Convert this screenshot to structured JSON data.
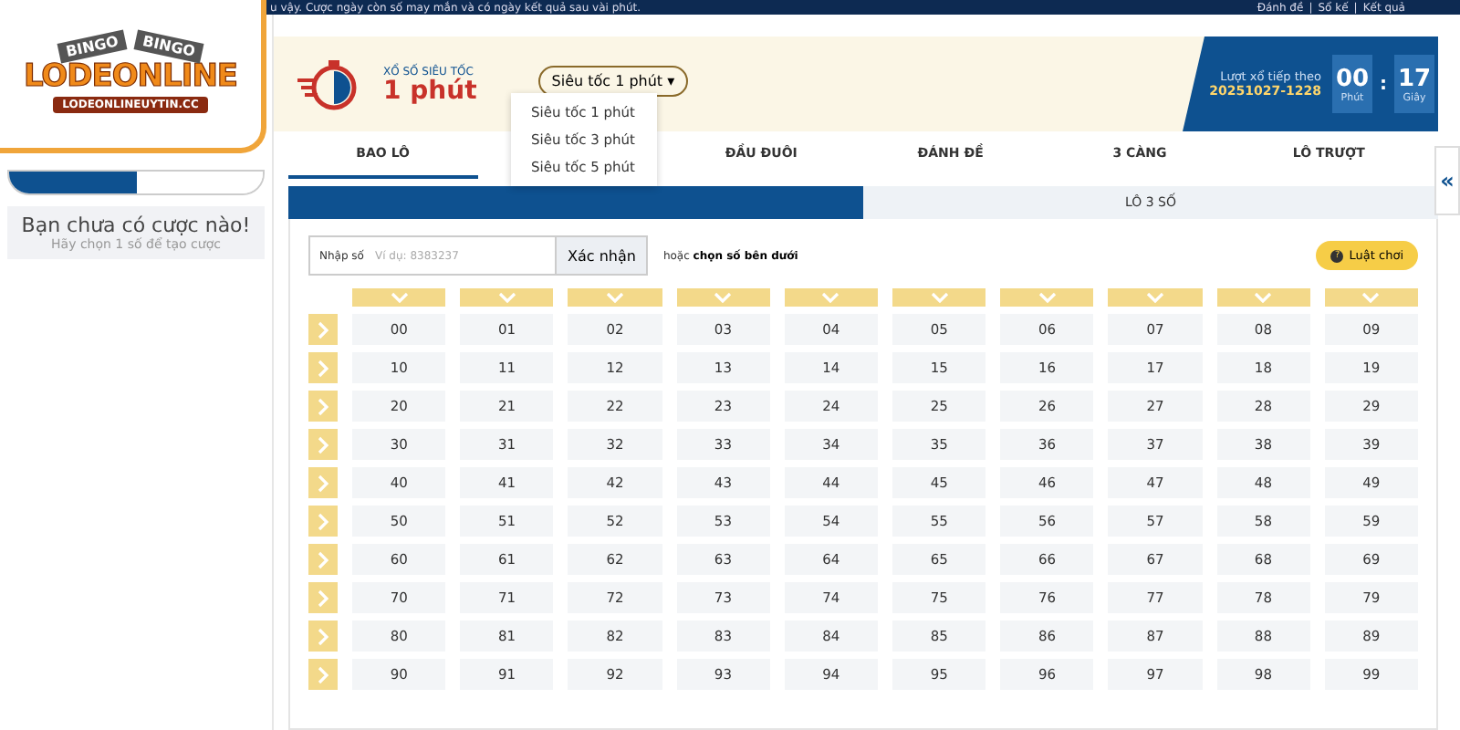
{
  "top_bar": {
    "notice": "u vậy. Cược ngày còn số may mắn và có ngày kết quả sau vài phút.",
    "links": [
      "Đánh đề",
      "Sổ kế",
      "Kết quả"
    ],
    "separator": "|"
  },
  "logo": {
    "badges": [
      "BINGO",
      "BINGO"
    ],
    "name": "LODEONLINE",
    "domain": "LODEONLINEUYTIN.CC"
  },
  "sidebar": {
    "empty_title": "Bạn chưa có cược nào!",
    "empty_hint": "Hãy chọn 1 số để tạo cược"
  },
  "game": {
    "caption": "XỔ SỐ SIÊU TỐC",
    "title": "1 phút"
  },
  "speed_dropdown": {
    "value": "Siêu tốc 1 phút",
    "caret": "▾",
    "options": [
      "Siêu tốc 1 phút",
      "Siêu tốc 3 phút",
      "Siêu tốc 5 phút"
    ]
  },
  "next_draw": {
    "label": "Lượt xổ tiếp theo",
    "draw_id": "20251027-1228",
    "minutes": "00",
    "minutes_unit": "Phút",
    "separator": ":",
    "seconds": "17",
    "seconds_unit": "Giây"
  },
  "tabs": [
    {
      "label": "BAO LÔ",
      "selected": true
    },
    {
      "label": "ĐẦU ĐUÔI",
      "selected": false
    },
    {
      "label": "ĐÁNH ĐỀ",
      "selected": false
    },
    {
      "label": "3 CÀNG",
      "selected": false
    },
    {
      "label": "LÔ TRƯỢT",
      "selected": false
    }
  ],
  "sub_tabs": [
    {
      "selected": true
    },
    {
      "label": "LÔ 3 SỐ",
      "selected": false
    }
  ],
  "number_input": {
    "label": "Nhập số",
    "placeholder": "Ví dụ: 8383237",
    "button": "Xác nhận",
    "hint": "hoặc **chọn số bên dưới**"
  },
  "rules_button": {
    "icon": "?",
    "label": "Luật chơi"
  },
  "collapse_button": "«",
  "grid": {
    "rows": [
      [
        "00",
        "01",
        "02",
        "03",
        "04",
        "05",
        "06",
        "07",
        "08",
        "09"
      ],
      [
        "10",
        "11",
        "12",
        "13",
        "14",
        "15",
        "16",
        "17",
        "18",
        "19"
      ],
      [
        "20",
        "21",
        "22",
        "23",
        "24",
        "25",
        "26",
        "27",
        "28",
        "29"
      ],
      [
        "30",
        "31",
        "32",
        "33",
        "34",
        "35",
        "36",
        "37",
        "38",
        "39"
      ],
      [
        "40",
        "41",
        "42",
        "43",
        "44",
        "45",
        "46",
        "47",
        "48",
        "49"
      ],
      [
        "50",
        "51",
        "52",
        "53",
        "54",
        "55",
        "56",
        "57",
        "58",
        "59"
      ],
      [
        "60",
        "61",
        "62",
        "63",
        "64",
        "65",
        "66",
        "67",
        "68",
        "69"
      ],
      [
        "70",
        "71",
        "72",
        "73",
        "74",
        "75",
        "76",
        "77",
        "78",
        "79"
      ],
      [
        "80",
        "81",
        "82",
        "83",
        "84",
        "85",
        "86",
        "87",
        "88",
        "89"
      ],
      [
        "90",
        "91",
        "92",
        "93",
        "94",
        "95",
        "96",
        "97",
        "98",
        "99"
      ]
    ]
  }
}
